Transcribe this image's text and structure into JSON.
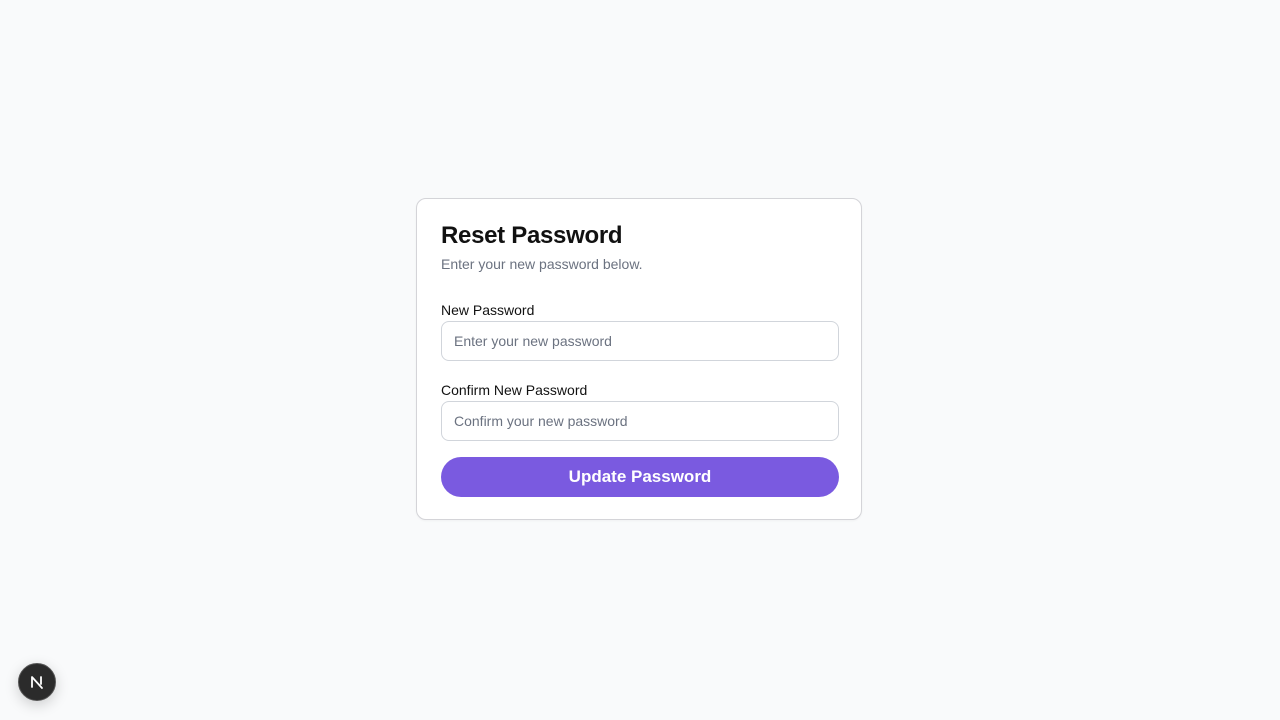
{
  "reset_form": {
    "title": "Reset Password",
    "subtitle": "Enter your new password below.",
    "new_password": {
      "label": "New Password",
      "value": "",
      "placeholder": "Enter your new password"
    },
    "confirm_password": {
      "label": "Confirm New Password",
      "value": "",
      "placeholder": "Confirm your new password"
    },
    "submit_label": "Update Password"
  },
  "colors": {
    "accent": "#7a5ae0",
    "background": "#f9fafb",
    "card": "#ffffff"
  },
  "dev_badge": {
    "icon": "nextjs-logo-icon"
  }
}
